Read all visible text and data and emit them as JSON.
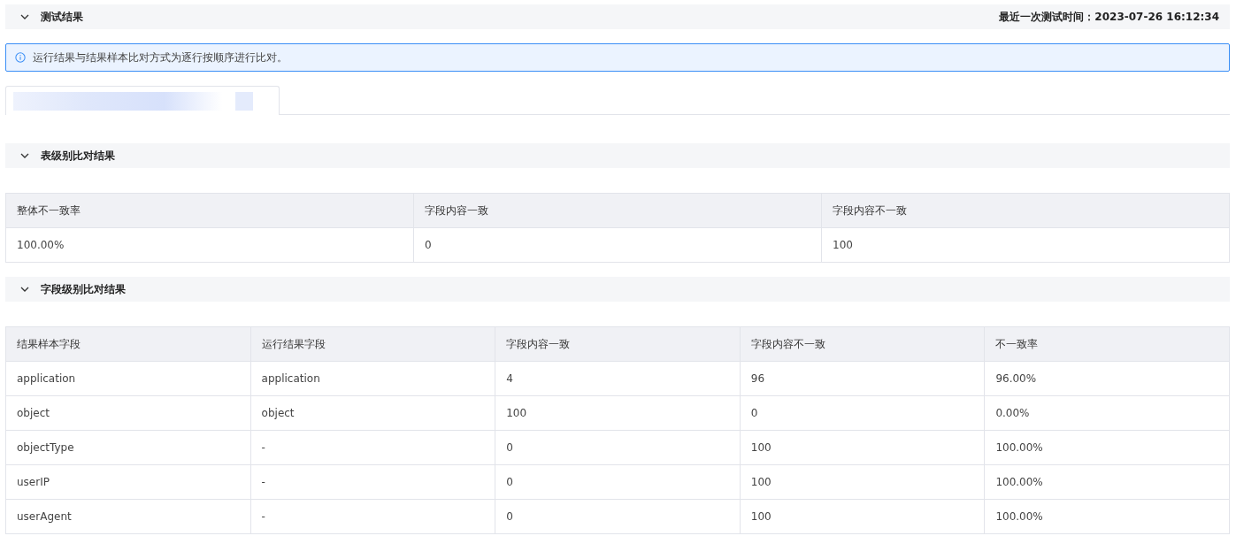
{
  "test_result": {
    "title": "测试结果",
    "expanded": true,
    "last_test_label": "最近一次测试时间：",
    "last_test_time": "2023-07-26 16:12:34"
  },
  "alert": {
    "text": "运行结果与结果样本比对方式为逐行按顺序进行比对。"
  },
  "tabs": [
    {
      "selected": true
    }
  ],
  "table_level": {
    "title": "表级别比对结果",
    "expanded": true,
    "columns": [
      "整体不一致率",
      "字段内容一致",
      "字段内容不一致"
    ],
    "rows": [
      [
        "100.00%",
        "0",
        "100"
      ]
    ]
  },
  "field_level": {
    "title": "字段级别比对结果",
    "expanded": true,
    "columns": [
      "结果样本字段",
      "运行结果字段",
      "字段内容一致",
      "字段内容不一致",
      "不一致率"
    ],
    "rows": [
      [
        "application",
        "application",
        "4",
        "96",
        "96.00%"
      ],
      [
        "object",
        "object",
        "100",
        "0",
        "0.00%"
      ],
      [
        "objectType",
        "-",
        "0",
        "100",
        "100.00%"
      ],
      [
        "userIP",
        "-",
        "0",
        "100",
        "100.00%"
      ],
      [
        "userAgent",
        "-",
        "0",
        "100",
        "100.00%"
      ]
    ]
  }
}
